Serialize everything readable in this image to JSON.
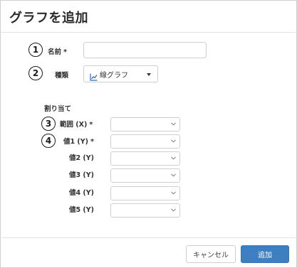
{
  "dialog": {
    "title": "グラフを追加"
  },
  "form": {
    "name": {
      "step": "1",
      "label": "名前",
      "required_mark": "*",
      "value": "",
      "placeholder": ""
    },
    "type": {
      "step": "2",
      "label": "種類",
      "selected": "線グラフ",
      "icon": "line-chart-icon"
    }
  },
  "assign": {
    "title": "割り当て",
    "rows": [
      {
        "step": "3",
        "label": "範囲 (X)",
        "required_mark": "*",
        "value": ""
      },
      {
        "step": "4",
        "label": "値1 (Y)",
        "required_mark": "*",
        "value": ""
      },
      {
        "step": "",
        "label": "値2 (Y)",
        "required_mark": "",
        "value": ""
      },
      {
        "step": "",
        "label": "値3 (Y)",
        "required_mark": "",
        "value": ""
      },
      {
        "step": "",
        "label": "値4 (Y)",
        "required_mark": "",
        "value": ""
      },
      {
        "step": "",
        "label": "値5 (Y)",
        "required_mark": "",
        "value": ""
      }
    ]
  },
  "footer": {
    "cancel_label": "キャンセル",
    "add_label": "追加"
  },
  "colors": {
    "primary": "#3d7fc1",
    "border": "#cfcfcf",
    "chart_icon": "#2f6fb5"
  }
}
